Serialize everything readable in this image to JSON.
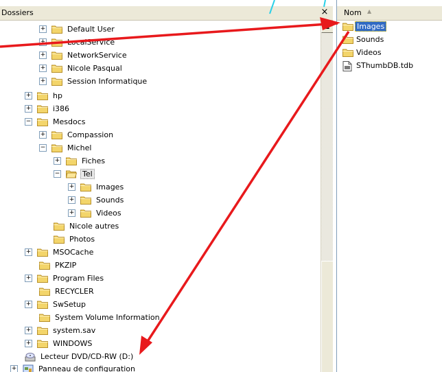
{
  "left_pane": {
    "title": "Dossiers",
    "close": "×",
    "tree": [
      {
        "label": "Default User",
        "expander": "+"
      },
      {
        "label": "LocalService",
        "expander": "+"
      },
      {
        "label": "NetworkService",
        "expander": "+"
      },
      {
        "label": "Nicole Pasqual",
        "expander": "+"
      },
      {
        "label": "Session Informatique",
        "expander": "+"
      },
      {
        "label": "hp",
        "expander": "+"
      },
      {
        "label": "i386",
        "expander": "+"
      },
      {
        "label": "Mesdocs",
        "expander": "−"
      },
      {
        "label": "Compassion",
        "expander": "+"
      },
      {
        "label": "Michel",
        "expander": "−"
      },
      {
        "label": "Fiches",
        "expander": "+"
      },
      {
        "label": "Tel",
        "expander": "−",
        "selected": true
      },
      {
        "label": "Images",
        "expander": "+"
      },
      {
        "label": "Sounds",
        "expander": "+"
      },
      {
        "label": "Videos",
        "expander": "+"
      },
      {
        "label": "Nicole autres",
        "expander": ""
      },
      {
        "label": "Photos",
        "expander": ""
      },
      {
        "label": "MSOCache",
        "expander": "+"
      },
      {
        "label": "PKZIP",
        "expander": ""
      },
      {
        "label": "Program Files",
        "expander": "+"
      },
      {
        "label": "RECYCLER",
        "expander": ""
      },
      {
        "label": "SwSetup",
        "expander": "+"
      },
      {
        "label": "System Volume Information",
        "expander": ""
      },
      {
        "label": "system.sav",
        "expander": "+"
      },
      {
        "label": "WINDOWS",
        "expander": "+"
      },
      {
        "label": "Lecteur DVD/CD-RW (D:)",
        "expander": "",
        "icon": "dvd-drive-icon"
      },
      {
        "label": "Panneau de configuration",
        "expander": "+",
        "icon": "control-panel-icon"
      }
    ]
  },
  "right_pane": {
    "column_header": "Nom",
    "sort_indicator": "▲",
    "files": [
      {
        "label": "Images",
        "icon": "folder-icon",
        "selected": true
      },
      {
        "label": "Sounds",
        "icon": "folder-icon"
      },
      {
        "label": "Videos",
        "icon": "folder-icon"
      },
      {
        "label": "SThumbDB.tdb",
        "icon": "file-icon"
      }
    ]
  },
  "colors": {
    "folder_fill": "#f3d56b",
    "folder_stroke": "#b8902a",
    "annotation_arrow": "#e8191c",
    "selection": "#316ac5"
  }
}
